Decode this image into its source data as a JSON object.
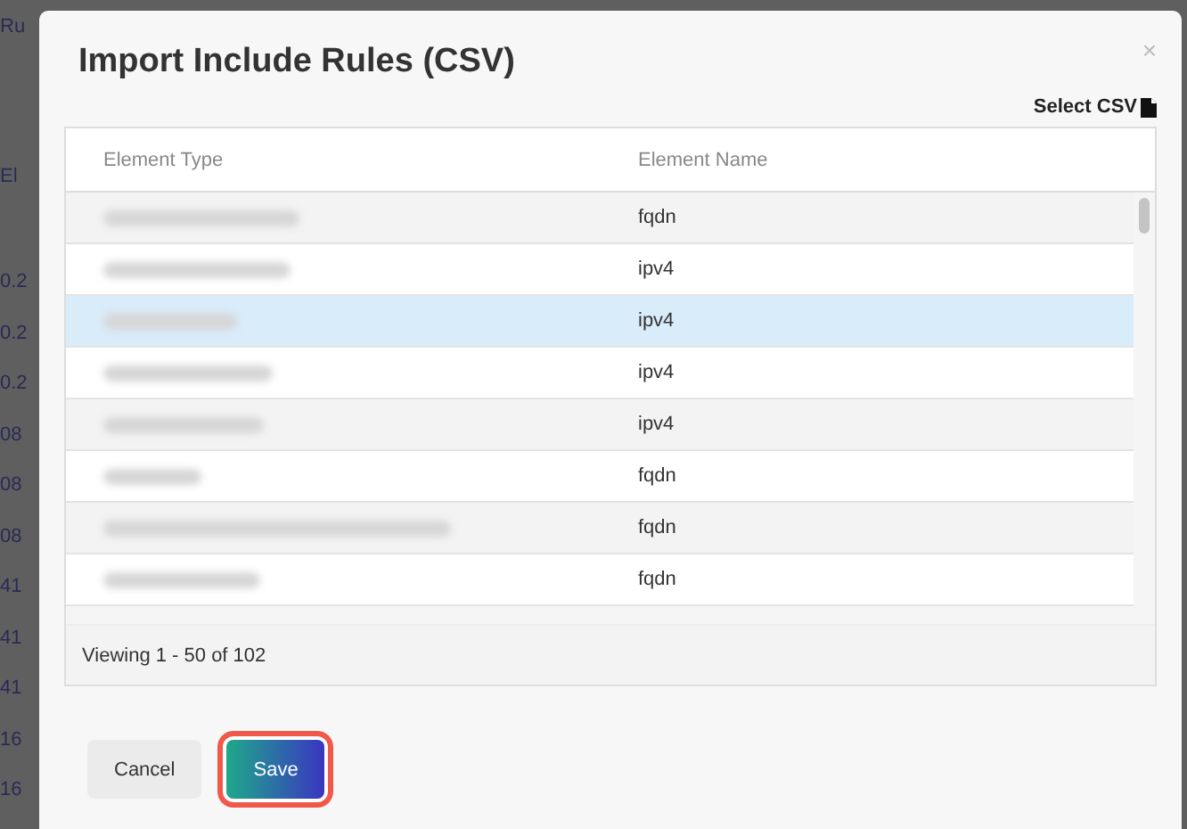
{
  "background_fragments": [
    "Ru",
    "El",
    "0.2",
    "0.2",
    "0.2",
    "08",
    "08",
    "08",
    "41",
    "41",
    "41",
    "16",
    "16"
  ],
  "dialog": {
    "title": "Import Include Rules (CSV)",
    "close": "×",
    "select_csv": "Select CSV",
    "table": {
      "columns": [
        "Element Type",
        "Element Name"
      ],
      "rows": [
        {
          "element_type_blurred": true,
          "element_name": "fqdn",
          "selected": false
        },
        {
          "element_type_blurred": true,
          "element_name": "ipv4",
          "selected": false
        },
        {
          "element_type_blurred": true,
          "element_name": "ipv4",
          "selected": true
        },
        {
          "element_type_blurred": true,
          "element_name": "ipv4",
          "selected": false
        },
        {
          "element_type_blurred": true,
          "element_name": "ipv4",
          "selected": false
        },
        {
          "element_type_blurred": true,
          "element_name": "fqdn",
          "selected": false
        },
        {
          "element_type_blurred": true,
          "element_name": "fqdn",
          "selected": false
        },
        {
          "element_type_blurred": true,
          "element_name": "fqdn",
          "selected": false
        }
      ],
      "footer": "Viewing 1 - 50 of 102"
    },
    "buttons": [
      {
        "label": "Cancel",
        "kind": "secondary",
        "highlighted": false
      },
      {
        "label": "Save",
        "kind": "primary",
        "highlighted": true
      }
    ]
  }
}
